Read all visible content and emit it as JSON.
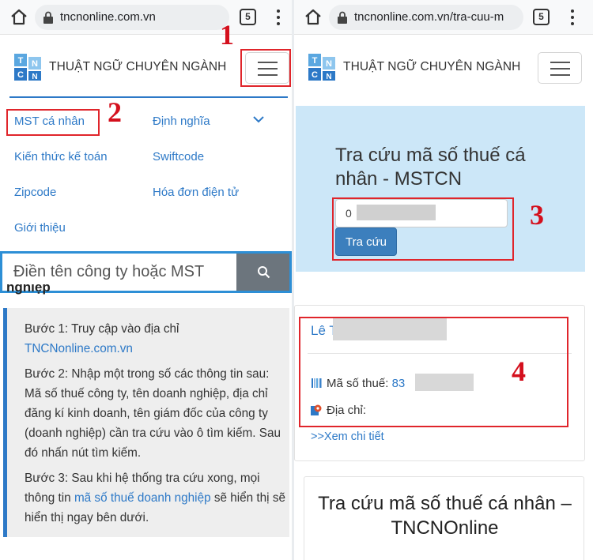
{
  "left": {
    "browser": {
      "url": "tncnonline.com.vn",
      "tab_count": "5"
    },
    "site": {
      "title": "THUẬT NGỮ CHUYÊN NGÀNH",
      "logo_letters": [
        "T",
        "N",
        "C",
        "N"
      ]
    },
    "annotations": {
      "one": "1",
      "two": "2"
    },
    "menu": {
      "items": [
        "MST cá nhân",
        "Định nghĩa",
        "Kiến thức kế toán",
        "Swiftcode",
        "Zipcode",
        "Hóa đơn điện tử",
        "Giới thiệu"
      ]
    },
    "search": {
      "placeholder": "Điền tên công ty hoặc MST"
    },
    "partial_heading": "nghiệp",
    "instructions": {
      "step1_text": "Bước 1: Truy cập vào địa chỉ",
      "step1_link": "TNCNonline.com.vn",
      "step2": "Bước 2: Nhập một trong số các thông tin sau: Mã số thuế công ty, tên doanh nghiệp, địa chỉ đăng kí kinh doanh, tên giám đốc của công ty (doanh nghiệp) cần tra cứu vào ô tìm kiếm. Sau đó nhấn nút tìm kiếm.",
      "step3_before": "Bước 3: Sau khi hệ thống tra cứu xong, mọi thông tin ",
      "step3_link": "mã số thuế doanh nghiệp",
      "step3_after": " sẽ hiển thị sẽ hiển thị ngay bên dưới."
    }
  },
  "right": {
    "browser": {
      "url": "tncnonline.com.vn/tra-cuu-m",
      "tab_count": "5"
    },
    "site": {
      "title": "THUẬT NGỮ CHUYÊN NGÀNH"
    },
    "annotations": {
      "three": "3",
      "four": "4"
    },
    "lookup": {
      "title": "Tra cứu mã số thuế cá nhân - MSTCN",
      "input_value": "0",
      "button": "Tra cứu"
    },
    "result": {
      "name": "Lê T",
      "mst_label": "Mã số thuế:",
      "mst_value": "83",
      "address_label": "Địa chỉ:",
      "detail_link": ">>Xem chi tiết"
    },
    "bottom_title": "Tra cứu mã số thuế cá nhân – TNCNOnline"
  },
  "colors": {
    "accent": "#2d79c7",
    "annotation_red": "#d4101d",
    "card_bg": "#cce7f8"
  }
}
